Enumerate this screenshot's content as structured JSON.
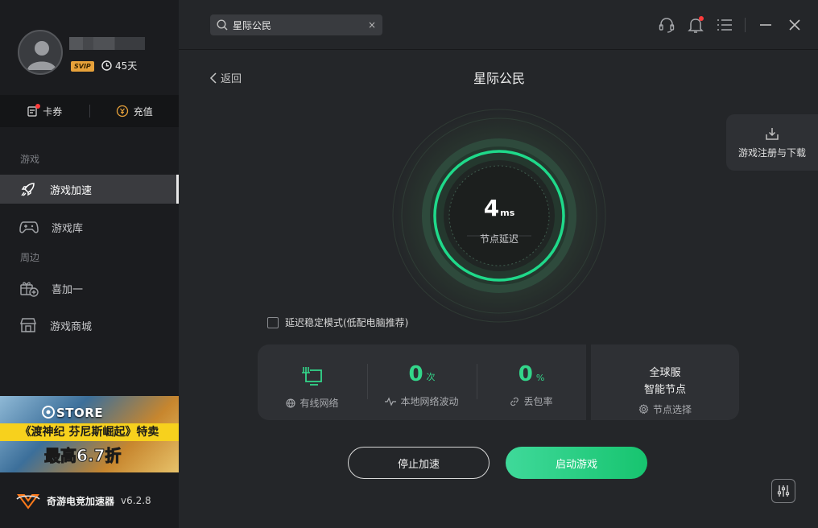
{
  "user": {
    "badge": "SVIP",
    "days": "45天"
  },
  "wallet": {
    "coupon": "卡券",
    "recharge": "充值"
  },
  "sidebar": {
    "section_games": "游戏",
    "section_around": "周边",
    "items": [
      {
        "label": "游戏加速",
        "icon": "rocket-icon"
      },
      {
        "label": "游戏库",
        "icon": "gamepad-icon"
      },
      {
        "label": "喜加一",
        "icon": "gift-plus-icon"
      },
      {
        "label": "游戏商城",
        "icon": "store-icon"
      }
    ]
  },
  "banner": {
    "store": "STORE",
    "line1": "《渡神纪 芬尼斯崛起》特卖",
    "line2": "最高6.7折"
  },
  "brand": {
    "name": "奇游电竞加速器",
    "version": "v6.2.8"
  },
  "search": {
    "value": "星际公民",
    "clear": "×"
  },
  "main": {
    "back": "返回",
    "title": "星际公民",
    "download": "游戏注册与下载"
  },
  "gauge": {
    "value": "4",
    "unit": "ms",
    "label": "节点延迟"
  },
  "stable_mode": "延迟稳定模式(低配电脑推荐)",
  "stats": {
    "wired": "有线网络",
    "jitter_value": "0",
    "jitter_unit": "次",
    "jitter_label": "本地网络波动",
    "loss_value": "0",
    "loss_unit": "%",
    "loss_label": "丢包率"
  },
  "node": {
    "line1": "全球服",
    "line2": "智能节点",
    "label": "节点选择"
  },
  "buttons": {
    "stop": "停止加速",
    "start": "启动游戏"
  },
  "colors": {
    "accent": "#33d68a",
    "sidebar_bg": "#1b1c1f",
    "main_bg": "#242629",
    "card_bg": "#2e3034",
    "badge": "#e7a13a",
    "notify": "#ff3b3b"
  }
}
